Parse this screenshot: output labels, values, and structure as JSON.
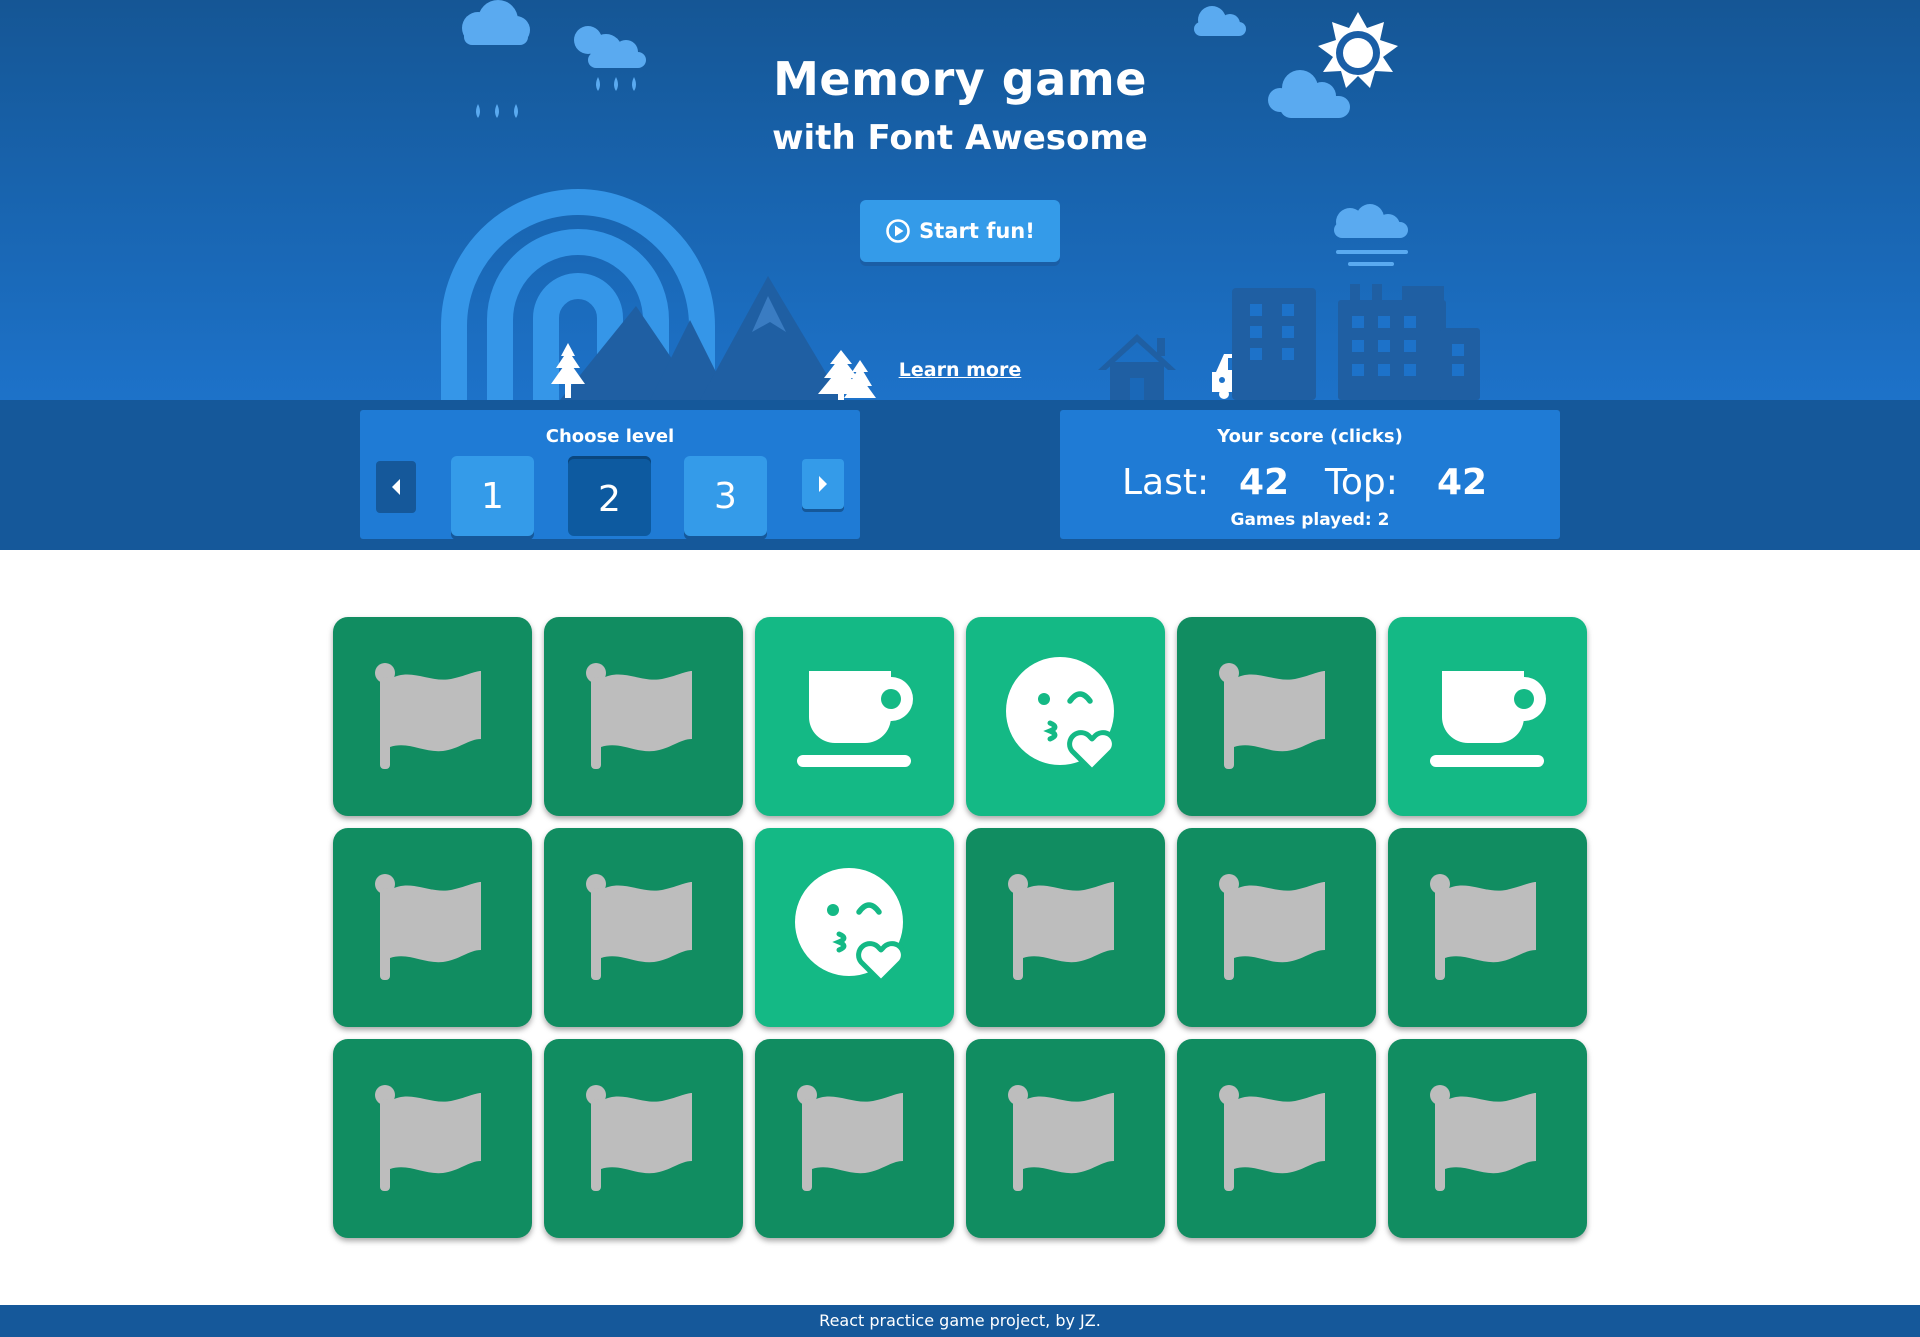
{
  "header": {
    "title": "Memory game",
    "subtitle": "with Font Awesome",
    "start_button": {
      "label": "Start fun!",
      "icon": "play-circle-icon"
    },
    "learn_more_label": "Learn more"
  },
  "level_panel": {
    "title": "Choose level",
    "levels": [
      "1",
      "2",
      "3"
    ],
    "selected_level": "2",
    "prev_icon": "caret-left-icon",
    "next_icon": "caret-right-icon"
  },
  "score_panel": {
    "title": "Your score (clicks)",
    "last_label": "Last:",
    "last_value": "42",
    "top_label": "Top:",
    "top_value": "42",
    "games_played": "Games played: 2"
  },
  "board": {
    "columns": 6,
    "rows": 3,
    "cards": [
      {
        "icon": "flag-icon",
        "revealed": false
      },
      {
        "icon": "flag-icon",
        "revealed": false
      },
      {
        "icon": "mug-saucer-icon",
        "revealed": true
      },
      {
        "icon": "face-kiss-wink-heart-icon",
        "revealed": true
      },
      {
        "icon": "flag-icon",
        "revealed": false
      },
      {
        "icon": "mug-saucer-icon",
        "revealed": true
      },
      {
        "icon": "flag-icon",
        "revealed": false
      },
      {
        "icon": "flag-icon",
        "revealed": false
      },
      {
        "icon": "face-kiss-wink-heart-icon",
        "revealed": true
      },
      {
        "icon": "flag-icon",
        "revealed": false
      },
      {
        "icon": "flag-icon",
        "revealed": false
      },
      {
        "icon": "flag-icon",
        "revealed": false
      },
      {
        "icon": "flag-icon",
        "revealed": false
      },
      {
        "icon": "flag-icon",
        "revealed": false
      },
      {
        "icon": "flag-icon",
        "revealed": false
      },
      {
        "icon": "flag-icon",
        "revealed": false
      },
      {
        "icon": "flag-icon",
        "revealed": false
      },
      {
        "icon": "flag-icon",
        "revealed": false
      }
    ]
  },
  "footer": {
    "text": "React practice game project, by JZ."
  },
  "colors": {
    "hero_top": "#155695",
    "hero_bottom": "#1d72c9",
    "control_bar": "#15589a",
    "panel": "#1f7bd5",
    "button": "#349be9",
    "card_hidden": "#118d61",
    "card_revealed": "#14b985",
    "flag_gray": "#bdbdbd"
  }
}
